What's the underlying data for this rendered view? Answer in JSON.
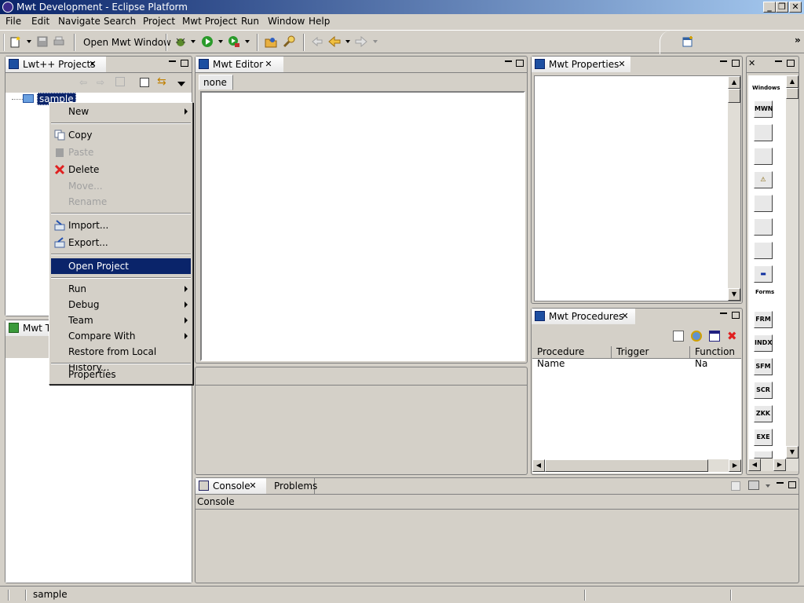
{
  "window": {
    "title": "Mwt Development - Eclipse Platform",
    "min": "_",
    "restore": "❐",
    "close": "✕"
  },
  "menu": [
    "File",
    "Edit",
    "Navigate",
    "Search",
    "Project",
    "Mwt Project",
    "Run",
    "Window",
    "Help"
  ],
  "toolbar": {
    "open_mwt_window": "Open Mwt Window"
  },
  "projects_panel": {
    "tab": "Lwt++ Projects",
    "tree_item": "sample"
  },
  "mwt_panel": {
    "tab": "Mwt T"
  },
  "editor": {
    "tab": "Mwt Editor",
    "inner_tab": "none"
  },
  "properties": {
    "tab": "Mwt Properties"
  },
  "procedures": {
    "tab": "Mwt Procedures",
    "columns": [
      "Procedure Name",
      "Trigger",
      "Function Na"
    ]
  },
  "palette": {
    "windows_label": "Windows",
    "forms_label": "Forms",
    "window_items": [
      "MWN",
      "",
      "",
      "⚠",
      "",
      "",
      "",
      "▬"
    ],
    "form_items": [
      "FRM",
      "INDX",
      "SFM",
      "SCR",
      "ZKK",
      "EXE",
      ""
    ]
  },
  "console": {
    "tabs": [
      "Console",
      "Problems"
    ],
    "title": "Console"
  },
  "context_menu": {
    "items": [
      {
        "label": "New",
        "sub": true,
        "state": "normal",
        "icon": ""
      },
      {
        "sep": true
      },
      {
        "label": "Copy",
        "state": "normal",
        "icon": "copy-icon"
      },
      {
        "label": "Paste",
        "state": "disabled",
        "icon": "paste-icon"
      },
      {
        "label": "Delete",
        "state": "normal",
        "icon": "delete-icon"
      },
      {
        "label": "Move...",
        "state": "disabled",
        "icon": ""
      },
      {
        "label": "Rename",
        "state": "disabled",
        "icon": ""
      },
      {
        "sep": true
      },
      {
        "label": "Import...",
        "state": "normal",
        "icon": "import-icon"
      },
      {
        "label": "Export...",
        "state": "normal",
        "icon": "export-icon"
      },
      {
        "sep": true
      },
      {
        "label": "Open Project",
        "state": "selected",
        "icon": ""
      },
      {
        "sep": true
      },
      {
        "label": "Run",
        "sub": true,
        "state": "normal",
        "icon": ""
      },
      {
        "label": "Debug",
        "sub": true,
        "state": "normal",
        "icon": ""
      },
      {
        "label": "Team",
        "sub": true,
        "state": "normal",
        "icon": ""
      },
      {
        "label": "Compare With",
        "sub": true,
        "state": "normal",
        "icon": ""
      },
      {
        "label": "Restore from Local History...",
        "state": "normal",
        "icon": ""
      },
      {
        "sep": true
      },
      {
        "label": "Properties",
        "state": "normal",
        "icon": ""
      }
    ]
  },
  "status": {
    "text": "sample"
  },
  "colors": {
    "selection": "#0a246a",
    "face": "#d4d0c8"
  }
}
